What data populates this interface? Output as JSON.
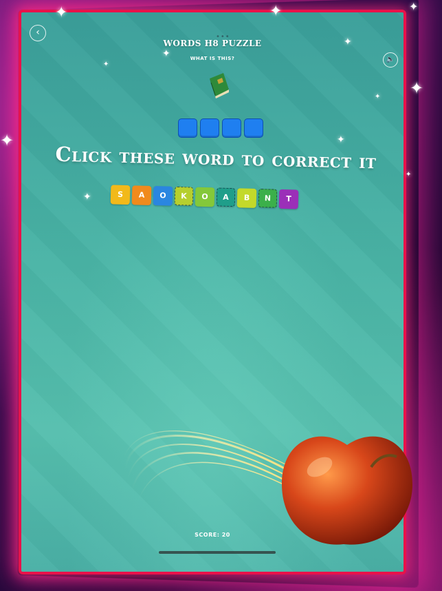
{
  "header": {
    "title": "WORDS H8 PUZZLE",
    "subtitle": "WHAT IS THIS?",
    "back_icon": "chevron-left-icon",
    "sound_icon": "speaker-icon"
  },
  "puzzle": {
    "image_icon": "book-icon",
    "answer_slot_count": 4,
    "instruction": "Click these word to correct it",
    "letters": [
      {
        "char": "S",
        "color": "#f2b91a",
        "dashed": false
      },
      {
        "char": "A",
        "color": "#f08a1c",
        "dashed": false
      },
      {
        "char": "O",
        "color": "#2a86e0",
        "dashed": false
      },
      {
        "char": "K",
        "color": "#b6cf2e",
        "dashed": true
      },
      {
        "char": "O",
        "color": "#84c83a",
        "dashed": false
      },
      {
        "char": "A",
        "color": "#1f9e8a",
        "dashed": true
      },
      {
        "char": "B",
        "color": "#c3d92a",
        "dashed": false
      },
      {
        "char": "N",
        "color": "#3bb04a",
        "dashed": true
      },
      {
        "char": "T",
        "color": "#9b2fb8",
        "dashed": false
      }
    ]
  },
  "footer": {
    "score": "SCORE: 20"
  },
  "colors": {
    "frame": "#e8124a",
    "answer_slot": "#1f7ff0",
    "board": "#4ab4a6"
  }
}
